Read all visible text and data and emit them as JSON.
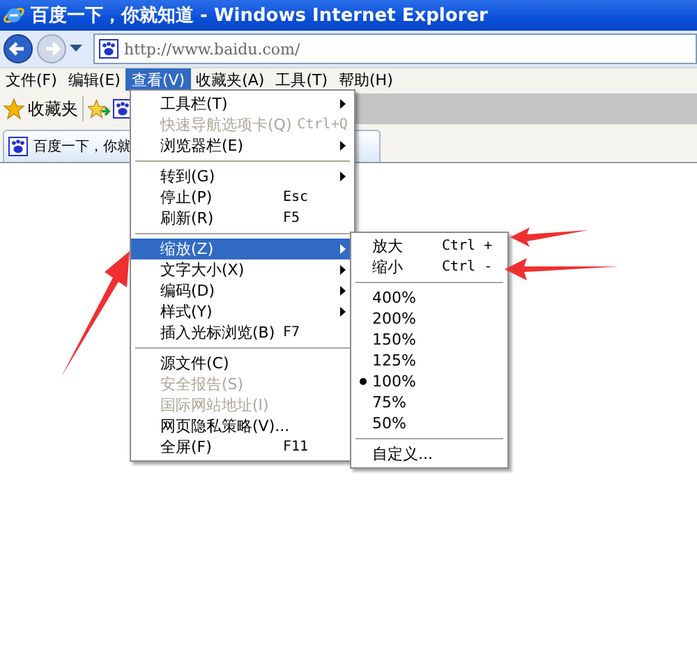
{
  "window": {
    "title": "百度一下，你就知道 - Windows Internet Explorer"
  },
  "address_bar": {
    "value": "http://www.baidu.com/"
  },
  "menu_bar": [
    {
      "label": "文件(F)",
      "selected": false
    },
    {
      "label": "编辑(E)",
      "selected": false
    },
    {
      "label": "查看(V)",
      "selected": true
    },
    {
      "label": "收藏夹(A)",
      "selected": false
    },
    {
      "label": "工具(T)",
      "selected": false
    },
    {
      "label": "帮助(H)",
      "selected": false
    }
  ],
  "favorites_bar": {
    "label": "收藏夹"
  },
  "tab": {
    "title": "百度一下，你就"
  },
  "view_menu": [
    {
      "kind": "item",
      "label": "工具栏(T)",
      "submenu": true,
      "disabled": false,
      "selected": false
    },
    {
      "kind": "item",
      "label": "快速导航选项卡(Q)",
      "shortcut": "Ctrl+Q",
      "submenu": false,
      "disabled": true,
      "selected": false
    },
    {
      "kind": "item",
      "label": "浏览器栏(E)",
      "submenu": true,
      "disabled": false,
      "selected": false
    },
    {
      "kind": "separator"
    },
    {
      "kind": "item",
      "label": "转到(G)",
      "submenu": true,
      "disabled": false,
      "selected": false
    },
    {
      "kind": "item",
      "label": "停止(P)",
      "shortcut": "Esc",
      "submenu": false,
      "disabled": false,
      "selected": false
    },
    {
      "kind": "item",
      "label": "刷新(R)",
      "shortcut": "F5",
      "submenu": false,
      "disabled": false,
      "selected": false
    },
    {
      "kind": "separator"
    },
    {
      "kind": "item",
      "label": "缩放(Z)",
      "submenu": true,
      "disabled": false,
      "selected": true
    },
    {
      "kind": "item",
      "label": "文字大小(X)",
      "submenu": true,
      "disabled": false,
      "selected": false
    },
    {
      "kind": "item",
      "label": "编码(D)",
      "submenu": true,
      "disabled": false,
      "selected": false
    },
    {
      "kind": "item",
      "label": "样式(Y)",
      "submenu": true,
      "disabled": false,
      "selected": false
    },
    {
      "kind": "item",
      "label": "插入光标浏览(B)",
      "shortcut": "F7",
      "submenu": false,
      "disabled": false,
      "selected": false
    },
    {
      "kind": "separator"
    },
    {
      "kind": "item",
      "label": "源文件(C)",
      "submenu": false,
      "disabled": false,
      "selected": false
    },
    {
      "kind": "item",
      "label": "安全报告(S)",
      "submenu": false,
      "disabled": true,
      "selected": false
    },
    {
      "kind": "item",
      "label": "国际网站地址(I)",
      "submenu": false,
      "disabled": true,
      "selected": false
    },
    {
      "kind": "item",
      "label": "网页隐私策略(V)...",
      "submenu": false,
      "disabled": false,
      "selected": false
    },
    {
      "kind": "item",
      "label": "全屏(F)",
      "shortcut": "F11",
      "submenu": false,
      "disabled": false,
      "selected": false
    }
  ],
  "zoom_menu": [
    {
      "kind": "item",
      "label": "放大",
      "shortcut": "Ctrl +",
      "checked": false
    },
    {
      "kind": "item",
      "label": "缩小",
      "shortcut": "Ctrl -",
      "checked": false
    },
    {
      "kind": "separator"
    },
    {
      "kind": "item",
      "label": "400%",
      "checked": false
    },
    {
      "kind": "item",
      "label": "200%",
      "checked": false
    },
    {
      "kind": "item",
      "label": "150%",
      "checked": false
    },
    {
      "kind": "item",
      "label": "125%",
      "checked": false
    },
    {
      "kind": "item",
      "label": "100%",
      "checked": true
    },
    {
      "kind": "item",
      "label": "75%",
      "checked": false
    },
    {
      "kind": "item",
      "label": "50%",
      "checked": false
    },
    {
      "kind": "separator"
    },
    {
      "kind": "item",
      "label": "自定义...",
      "checked": false
    }
  ]
}
